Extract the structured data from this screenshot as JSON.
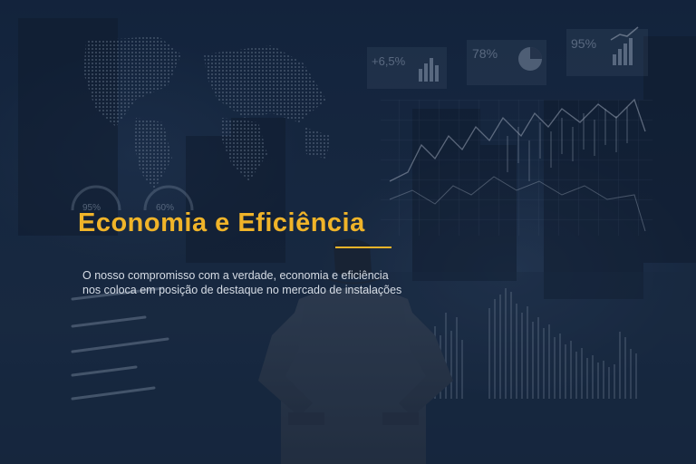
{
  "hero": {
    "title": "Economia e Eficiência",
    "description_line1": "O nosso compromisso com a verdade, economia e eficiência",
    "description_line2": "nos coloca em posição de destaque no mercado de instalações"
  },
  "hud": {
    "stat_1": "+6,5%",
    "stat_2": "78%",
    "stat_3": "95%",
    "gauge_1": "95%",
    "gauge_2": "60%"
  },
  "colors": {
    "accent": "#f0b429",
    "background": "#1a2c45",
    "text": "#d7dde6"
  }
}
